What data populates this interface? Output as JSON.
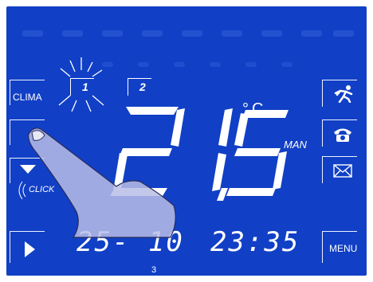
{
  "display": {
    "left_buttons": {
      "clima_label": "CLIMA",
      "click_label": "CLICK"
    },
    "programs": [
      "1",
      "2"
    ],
    "temperature": {
      "integer": "21",
      "decimal": "5",
      "unit": "°C",
      "mode": "MAN"
    },
    "date": "25- 10",
    "time": "23:35",
    "footnote": "3",
    "right_buttons": {
      "menu_label": "MENU"
    }
  },
  "icons": {
    "away": "running-person-icon",
    "phone": "telephone-icon",
    "mail": "envelope-icon",
    "down": "triangle-down-icon",
    "play": "triangle-right-icon",
    "blink": "blink-rays-icon",
    "hand": "pointing-hand-icon"
  },
  "colors": {
    "background": "#1140c6",
    "segment": "#ffffff",
    "hand": "#b8bde6"
  }
}
